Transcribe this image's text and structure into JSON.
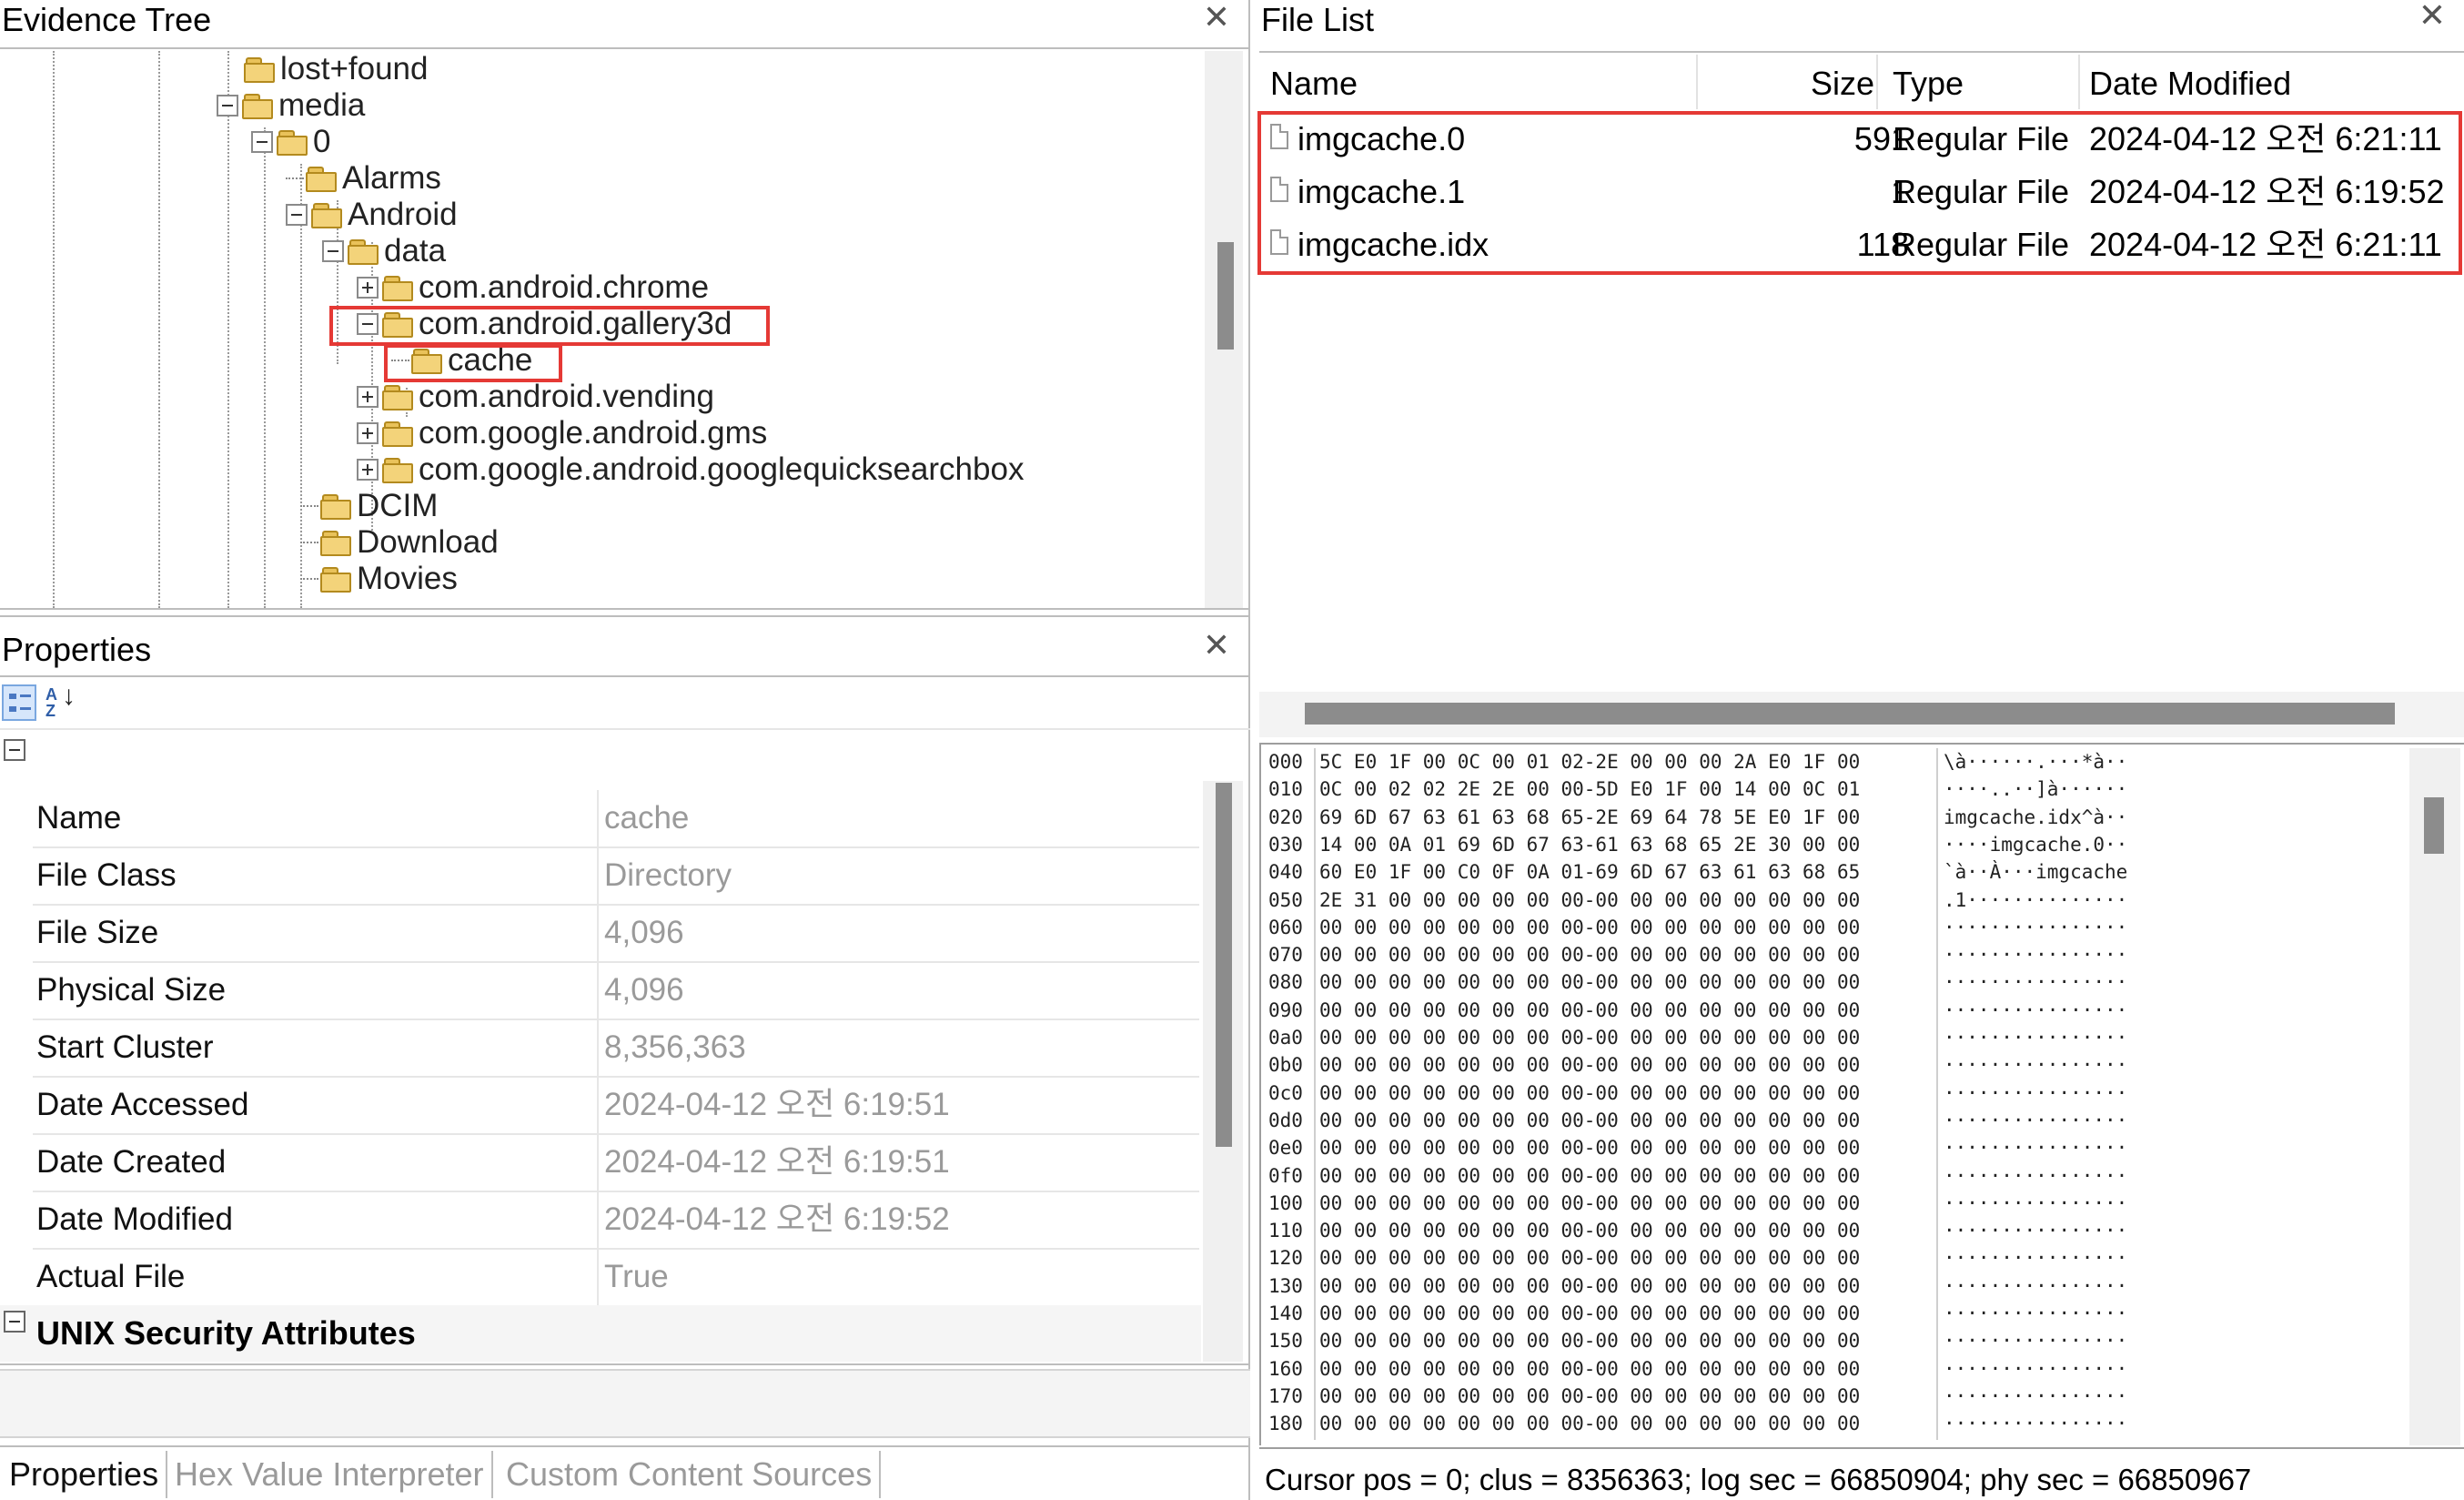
{
  "evidence_tree": {
    "title": "Evidence Tree",
    "nodes": [
      {
        "label": "lost+found",
        "expander": "none"
      },
      {
        "label": "media",
        "expander": "minus"
      },
      {
        "label": "0",
        "expander": "minus"
      },
      {
        "label": "Alarms",
        "expander": "none"
      },
      {
        "label": "Android",
        "expander": "minus"
      },
      {
        "label": "data",
        "expander": "minus"
      },
      {
        "label": "com.android.chrome",
        "expander": "plus"
      },
      {
        "label": "com.android.gallery3d",
        "expander": "minus"
      },
      {
        "label": "cache",
        "expander": "none"
      },
      {
        "label": "com.android.vending",
        "expander": "plus"
      },
      {
        "label": "com.google.android.gms",
        "expander": "plus"
      },
      {
        "label": "com.google.android.googlequicksearchbox",
        "expander": "plus"
      },
      {
        "label": "DCIM",
        "expander": "none"
      },
      {
        "label": "Download",
        "expander": "none"
      },
      {
        "label": "Movies",
        "expander": "none"
      }
    ]
  },
  "file_list": {
    "title": "File List",
    "columns": {
      "name": "Name",
      "size": "Size",
      "type": "Type",
      "date": "Date Modified"
    },
    "rows": [
      {
        "name": "imgcache.0",
        "size": "591",
        "type": "Regular File",
        "date": "2024-04-12 오전 6:21:11"
      },
      {
        "name": "imgcache.1",
        "size": "1",
        "type": "Regular File",
        "date": "2024-04-12 오전 6:19:52"
      },
      {
        "name": "imgcache.idx",
        "size": "118",
        "type": "Regular File",
        "date": "2024-04-12 오전 6:21:11"
      }
    ]
  },
  "properties": {
    "title": "Properties",
    "rows": [
      {
        "label": "Name",
        "value": "cache"
      },
      {
        "label": "File Class",
        "value": "Directory"
      },
      {
        "label": "File Size",
        "value": "4,096"
      },
      {
        "label": "Physical Size",
        "value": "4,096"
      },
      {
        "label": "Start Cluster",
        "value": "8,356,363"
      },
      {
        "label": "Date Accessed",
        "value": "2024-04-12 오전 6:19:51"
      },
      {
        "label": "Date Created",
        "value": "2024-04-12 오전 6:19:51"
      },
      {
        "label": "Date Modified",
        "value": "2024-04-12 오전 6:19:52"
      },
      {
        "label": "Actual File",
        "value": "True"
      }
    ],
    "section_header": "UNIX Security Attributes"
  },
  "hex_view": {
    "rows": [
      {
        "off": "000",
        "bytes": "5C E0 1F 00 0C 00 01 02-2E 00 00 00 2A E0 1F 00",
        "ascii": "\\à······.···*à··"
      },
      {
        "off": "010",
        "bytes": "0C 00 02 02 2E 2E 00 00-5D E0 1F 00 14 00 0C 01",
        "ascii": "····..··]à······"
      },
      {
        "off": "020",
        "bytes": "69 6D 67 63 61 63 68 65-2E 69 64 78 5E E0 1F 00",
        "ascii": "imgcache.idx^à··"
      },
      {
        "off": "030",
        "bytes": "14 00 0A 01 69 6D 67 63-61 63 68 65 2E 30 00 00",
        "ascii": "····imgcache.0··"
      },
      {
        "off": "040",
        "bytes": "60 E0 1F 00 C0 0F 0A 01-69 6D 67 63 61 63 68 65",
        "ascii": "`à··À···imgcache"
      },
      {
        "off": "050",
        "bytes": "2E 31 00 00 00 00 00 00-00 00 00 00 00 00 00 00",
        "ascii": ".1··············"
      },
      {
        "off": "060",
        "bytes": "00 00 00 00 00 00 00 00-00 00 00 00 00 00 00 00",
        "ascii": "················"
      },
      {
        "off": "070",
        "bytes": "00 00 00 00 00 00 00 00-00 00 00 00 00 00 00 00",
        "ascii": "················"
      },
      {
        "off": "080",
        "bytes": "00 00 00 00 00 00 00 00-00 00 00 00 00 00 00 00",
        "ascii": "················"
      },
      {
        "off": "090",
        "bytes": "00 00 00 00 00 00 00 00-00 00 00 00 00 00 00 00",
        "ascii": "················"
      },
      {
        "off": "0a0",
        "bytes": "00 00 00 00 00 00 00 00-00 00 00 00 00 00 00 00",
        "ascii": "················"
      },
      {
        "off": "0b0",
        "bytes": "00 00 00 00 00 00 00 00-00 00 00 00 00 00 00 00",
        "ascii": "················"
      },
      {
        "off": "0c0",
        "bytes": "00 00 00 00 00 00 00 00-00 00 00 00 00 00 00 00",
        "ascii": "················"
      },
      {
        "off": "0d0",
        "bytes": "00 00 00 00 00 00 00 00-00 00 00 00 00 00 00 00",
        "ascii": "················"
      },
      {
        "off": "0e0",
        "bytes": "00 00 00 00 00 00 00 00-00 00 00 00 00 00 00 00",
        "ascii": "················"
      },
      {
        "off": "0f0",
        "bytes": "00 00 00 00 00 00 00 00-00 00 00 00 00 00 00 00",
        "ascii": "················"
      },
      {
        "off": "100",
        "bytes": "00 00 00 00 00 00 00 00-00 00 00 00 00 00 00 00",
        "ascii": "················"
      },
      {
        "off": "110",
        "bytes": "00 00 00 00 00 00 00 00-00 00 00 00 00 00 00 00",
        "ascii": "················"
      },
      {
        "off": "120",
        "bytes": "00 00 00 00 00 00 00 00-00 00 00 00 00 00 00 00",
        "ascii": "················"
      },
      {
        "off": "130",
        "bytes": "00 00 00 00 00 00 00 00-00 00 00 00 00 00 00 00",
        "ascii": "················"
      },
      {
        "off": "140",
        "bytes": "00 00 00 00 00 00 00 00-00 00 00 00 00 00 00 00",
        "ascii": "················"
      },
      {
        "off": "150",
        "bytes": "00 00 00 00 00 00 00 00-00 00 00 00 00 00 00 00",
        "ascii": "················"
      },
      {
        "off": "160",
        "bytes": "00 00 00 00 00 00 00 00-00 00 00 00 00 00 00 00",
        "ascii": "················"
      },
      {
        "off": "170",
        "bytes": "00 00 00 00 00 00 00 00-00 00 00 00 00 00 00 00",
        "ascii": "················"
      },
      {
        "off": "180",
        "bytes": "00 00 00 00 00 00 00 00-00 00 00 00 00 00 00 00",
        "ascii": "················"
      }
    ]
  },
  "status_bar": {
    "text": "Cursor pos = 0; clus = 8356363; log sec = 66850904; phy sec = 66850967"
  },
  "bottom_tabs": [
    "Properties",
    "Hex Value Interpreter",
    "Custom Content Sources"
  ],
  "colors": {
    "highlight": "#e53935",
    "folder": "#f3d37a",
    "muted_value": "#9a9a9a",
    "scroll_thumb": "#8c8c8c"
  },
  "icons": {
    "close": "close-icon",
    "folder": "folder-icon",
    "file": "file-icon",
    "categorized": "categorized-view-icon",
    "sort": "sort-alpha-icon"
  }
}
